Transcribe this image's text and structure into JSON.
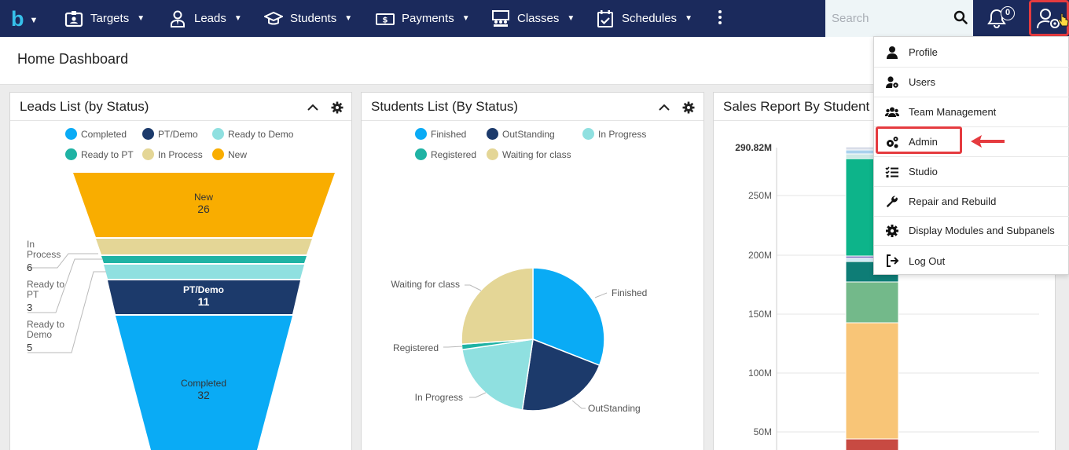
{
  "nav": {
    "logo": "b",
    "items": [
      {
        "label": "Targets",
        "icon": "id-card-icon"
      },
      {
        "label": "Leads",
        "icon": "user-tie-icon"
      },
      {
        "label": "Students",
        "icon": "graduation-cap-icon"
      },
      {
        "label": "Payments",
        "icon": "money-bill-icon"
      },
      {
        "label": "Classes",
        "icon": "classroom-icon"
      },
      {
        "label": "Schedules",
        "icon": "calendar-check-icon"
      }
    ],
    "search_placeholder": "Search",
    "notification_count": "0"
  },
  "page": {
    "title": "Home Dashboard"
  },
  "panels": {
    "leads": {
      "title": "Leads List (by Status)",
      "legend": [
        {
          "label": "Completed",
          "color": "#0aabf5"
        },
        {
          "label": "PT/Demo",
          "color": "#1c3a6b"
        },
        {
          "label": "Ready to Demo",
          "color": "#8fe0e0"
        },
        {
          "label": "Ready to PT",
          "color": "#1fb3a4"
        },
        {
          "label": "In Process",
          "color": "#e4d696"
        },
        {
          "label": "New",
          "color": "#f9ad00"
        }
      ],
      "funnel": {
        "new": {
          "label": "New",
          "value": "26"
        },
        "ptdemo": {
          "label": "PT/Demo",
          "value": "11"
        },
        "completed": {
          "label": "Completed",
          "value": "32"
        },
        "inprocess": {
          "line1": "In",
          "line2": "Process",
          "value": "6"
        },
        "readypt": {
          "line1": "Ready to",
          "line2": "PT",
          "value": "3"
        },
        "readydemo": {
          "line1": "Ready to",
          "line2": "Demo",
          "value": "5"
        }
      }
    },
    "students": {
      "title": "Students List (By Status)",
      "legend": [
        {
          "label": "Finished",
          "color": "#0aabf5"
        },
        {
          "label": "OutStanding",
          "color": "#1c3a6b"
        },
        {
          "label": "In Progress",
          "color": "#8fe0e0"
        },
        {
          "label": "Registered",
          "color": "#1fb3a4"
        },
        {
          "label": "Waiting for class",
          "color": "#e4d696"
        }
      ],
      "pie_labels": {
        "finished": "Finished",
        "outstanding": "OutStanding",
        "inprogress": "In Progress",
        "registered": "Registered",
        "waiting": "Waiting for class"
      }
    },
    "sales": {
      "title": "Sales Report By Student",
      "axis": {
        "top": "290.82M",
        "t250": "250M",
        "t200": "200M",
        "t150": "150M",
        "t100": "100M",
        "t50": "50M"
      }
    }
  },
  "user_menu": {
    "items": [
      {
        "label": "Profile",
        "icon": "user-icon"
      },
      {
        "label": "Users",
        "icon": "user-gear-icon"
      },
      {
        "label": "Team Management",
        "icon": "users-icon"
      },
      {
        "label": "Admin",
        "icon": "gears-icon"
      },
      {
        "label": "Studio",
        "icon": "list-check-icon"
      },
      {
        "label": "Repair and Rebuild",
        "icon": "wrench-icon"
      },
      {
        "label": "Display Modules and Subpanels",
        "icon": "gear-icon"
      },
      {
        "label": "Log Out",
        "icon": "sign-out-icon"
      }
    ]
  }
}
